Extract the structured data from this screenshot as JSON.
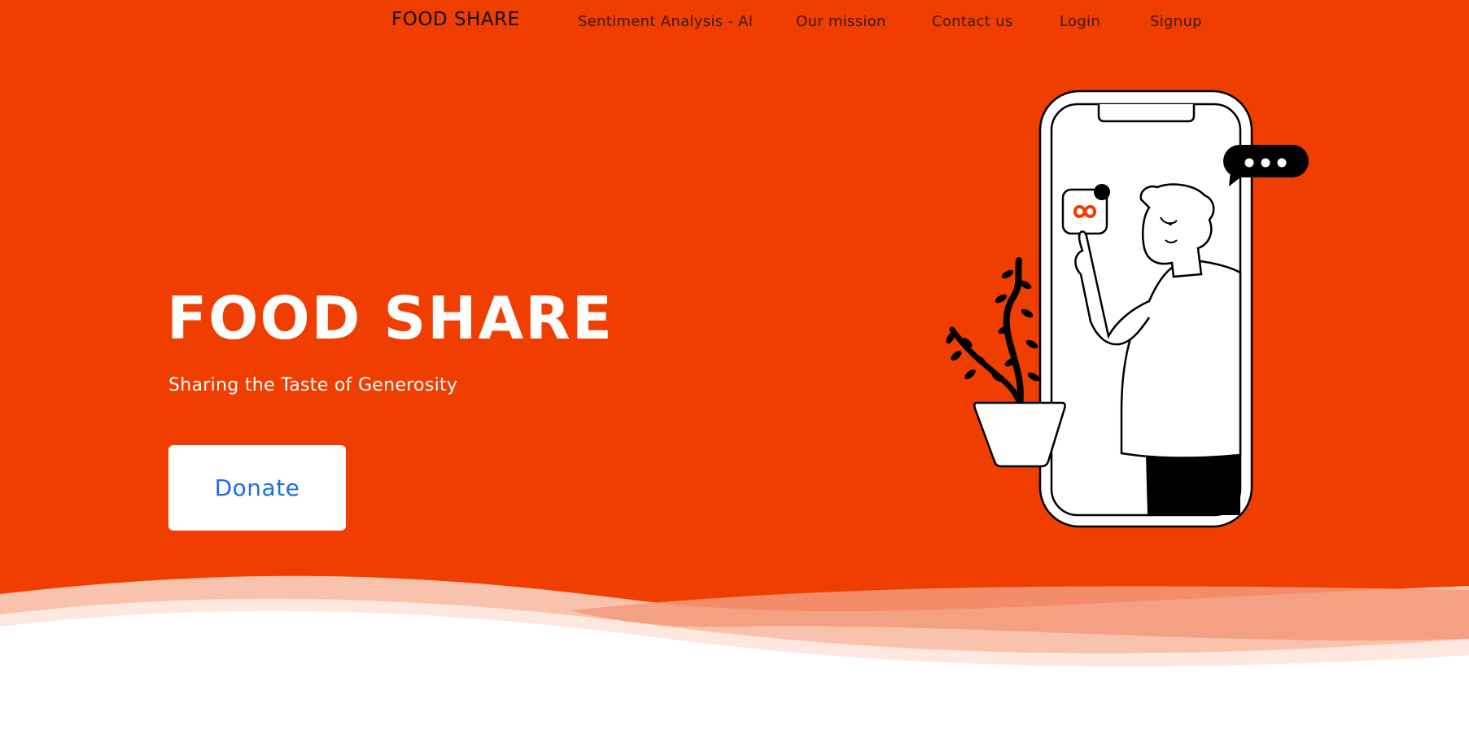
{
  "nav": {
    "brand": "FOOD SHARE",
    "links": [
      {
        "label": "Sentiment Analysis - AI"
      },
      {
        "label": "Our mission"
      },
      {
        "label": "Contact us"
      },
      {
        "label": "Login"
      },
      {
        "label": "Signup"
      }
    ]
  },
  "hero": {
    "title": "FOOD SHARE",
    "subtitle": "Sharing the Taste of Generosity",
    "donate_label": "Donate"
  },
  "illustration": {
    "icons": [
      "phone-icon",
      "person-illustration",
      "plant-icon",
      "chat-bubble-icon",
      "app-infinity-icon"
    ]
  },
  "colors": {
    "hero_bg": "#ef3e00",
    "button_text": "#1a6ee8",
    "wave_light": "#f9c2ad",
    "wave_mid": "#f39a7a"
  }
}
